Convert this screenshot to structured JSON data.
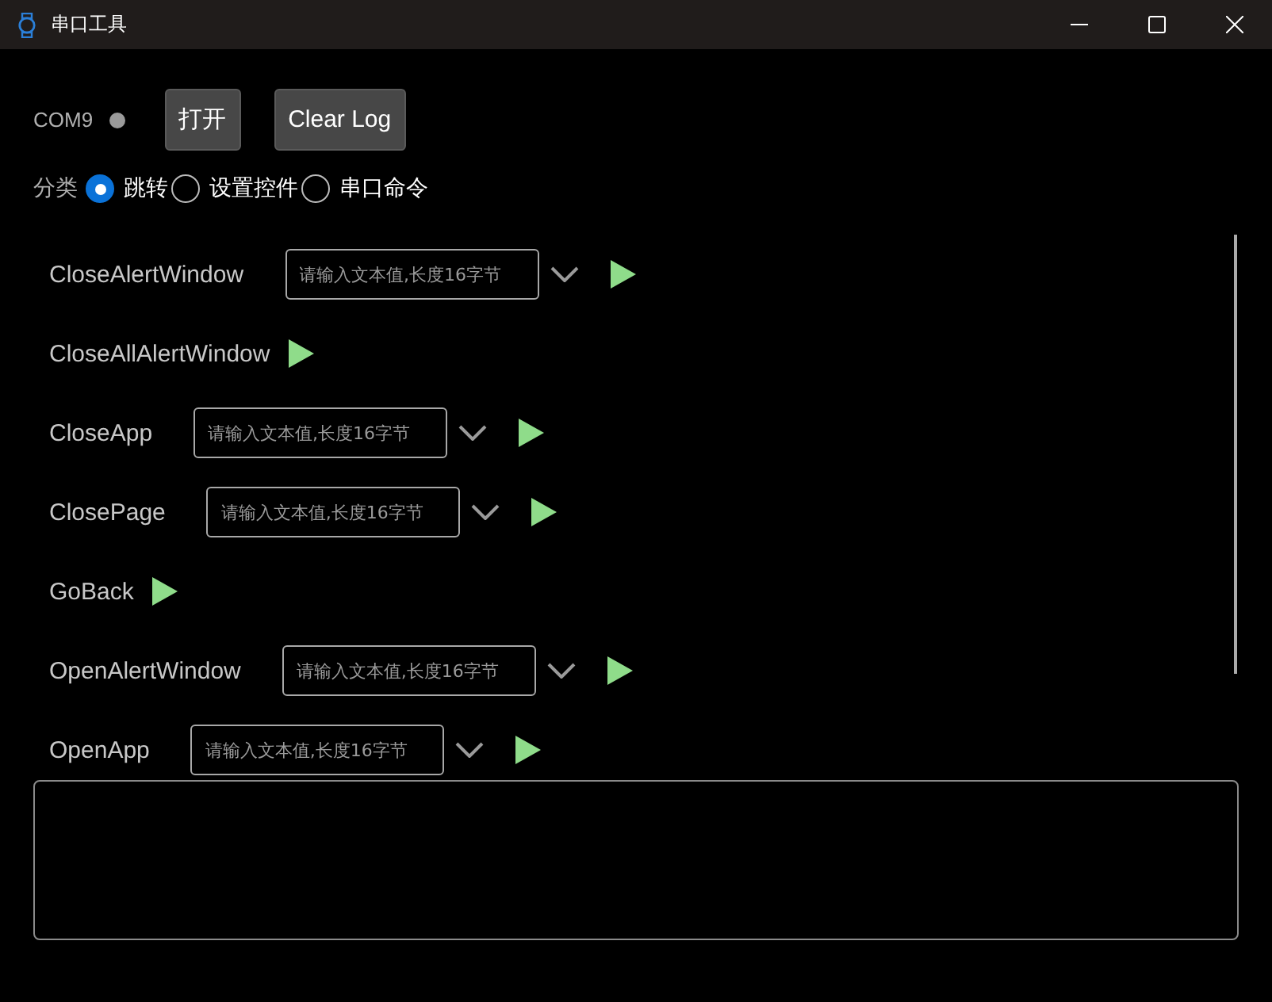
{
  "window": {
    "title": "串口工具"
  },
  "port": {
    "name": "COM9",
    "connected": false
  },
  "buttons": [
    "打开",
    "Clear Log"
  ],
  "category": {
    "label": "分类",
    "options": [
      {
        "label": "跳转",
        "selected": true
      },
      {
        "label": "设置控件",
        "selected": false
      },
      {
        "label": "串口命令",
        "selected": false
      }
    ]
  },
  "commands": [
    {
      "name": "CloseAlertWindow",
      "kind": "input",
      "placeholder": "请输入文本值,长度16字节"
    },
    {
      "name": "CloseAllAlertWindow",
      "kind": "plain"
    },
    {
      "name": "CloseApp",
      "kind": "input",
      "placeholder": "请输入文本值,长度16字节"
    },
    {
      "name": "ClosePage",
      "kind": "input",
      "placeholder": "请输入文本值,长度16字节"
    },
    {
      "name": "GoBack",
      "kind": "plain"
    },
    {
      "name": "OpenAlertWindow",
      "kind": "input",
      "placeholder": "请输入文本值,长度16字节"
    },
    {
      "name": "OpenApp",
      "kind": "input",
      "placeholder": "请输入文本值,长度16字节"
    }
  ]
}
